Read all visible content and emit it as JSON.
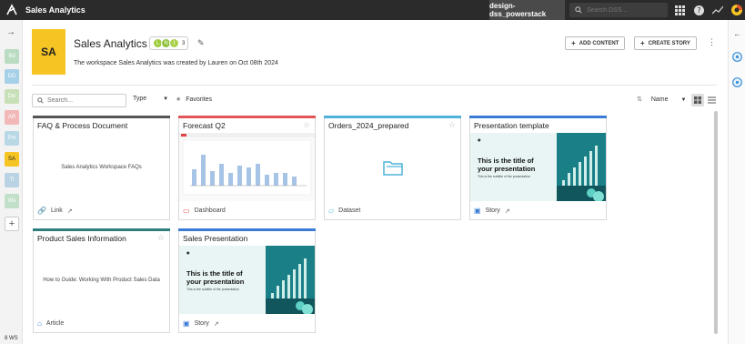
{
  "topbar": {
    "app_title": "Sales Analytics",
    "instance": "design-dss_powerstack",
    "search_placeholder": "Search DSS..."
  },
  "leftrail": {
    "items": [
      {
        "label": "Bd",
        "color": "#b9dcc3"
      },
      {
        "label": "DD",
        "color": "#a6cfe8"
      },
      {
        "label": "Dw",
        "color": "#c8e0b7"
      },
      {
        "label": "AR",
        "color": "#f2b8b8"
      },
      {
        "label": "Pm",
        "color": "#b8d8e6"
      },
      {
        "label": "SA",
        "color": "#f6c524"
      },
      {
        "label": "Tl",
        "color": "#b9d3e3"
      },
      {
        "label": "Ws",
        "color": "#c2e0c9"
      }
    ],
    "count": "8 WS"
  },
  "header": {
    "avatar": "SA",
    "title": "Sales Analytics",
    "members": [
      "L",
      "N",
      "I"
    ],
    "member_count": "3",
    "description": "The workspace Sales Analytics was created by Lauren on Oct 08th 2024",
    "add_content": "ADD CONTENT",
    "create_story": "CREATE STORY"
  },
  "filters": {
    "search_placeholder": "Search...",
    "type": "Type",
    "favorites": "Favorites",
    "sort": "Name"
  },
  "cards": [
    {
      "title": "FAQ & Process Document",
      "body": "Sales Analytics Workspace FAQs",
      "type": "Link",
      "accent": "#555555"
    },
    {
      "title": "Forecast Q2",
      "type": "Dashboard",
      "accent": "#e05555"
    },
    {
      "title": "Orders_2024_prepared",
      "type": "Dataset",
      "accent": "#4fb3d9"
    },
    {
      "title": "Presentation template",
      "type": "Story",
      "accent": "#3a7bd5",
      "slide_title": "This is the title of your presentation",
      "slide_sub": "This is the subtitle of the presentation"
    },
    {
      "title": "Product Sales Information",
      "body": "How to Guide: Working With Product Sales Data",
      "type": "Article",
      "accent": "#2f7e7e"
    },
    {
      "title": "Sales Presentation",
      "type": "Story",
      "accent": "#3a7bd5",
      "slide_title": "This is the title of your presentation",
      "slide_sub": "This is the subtitle of the presentation"
    }
  ]
}
